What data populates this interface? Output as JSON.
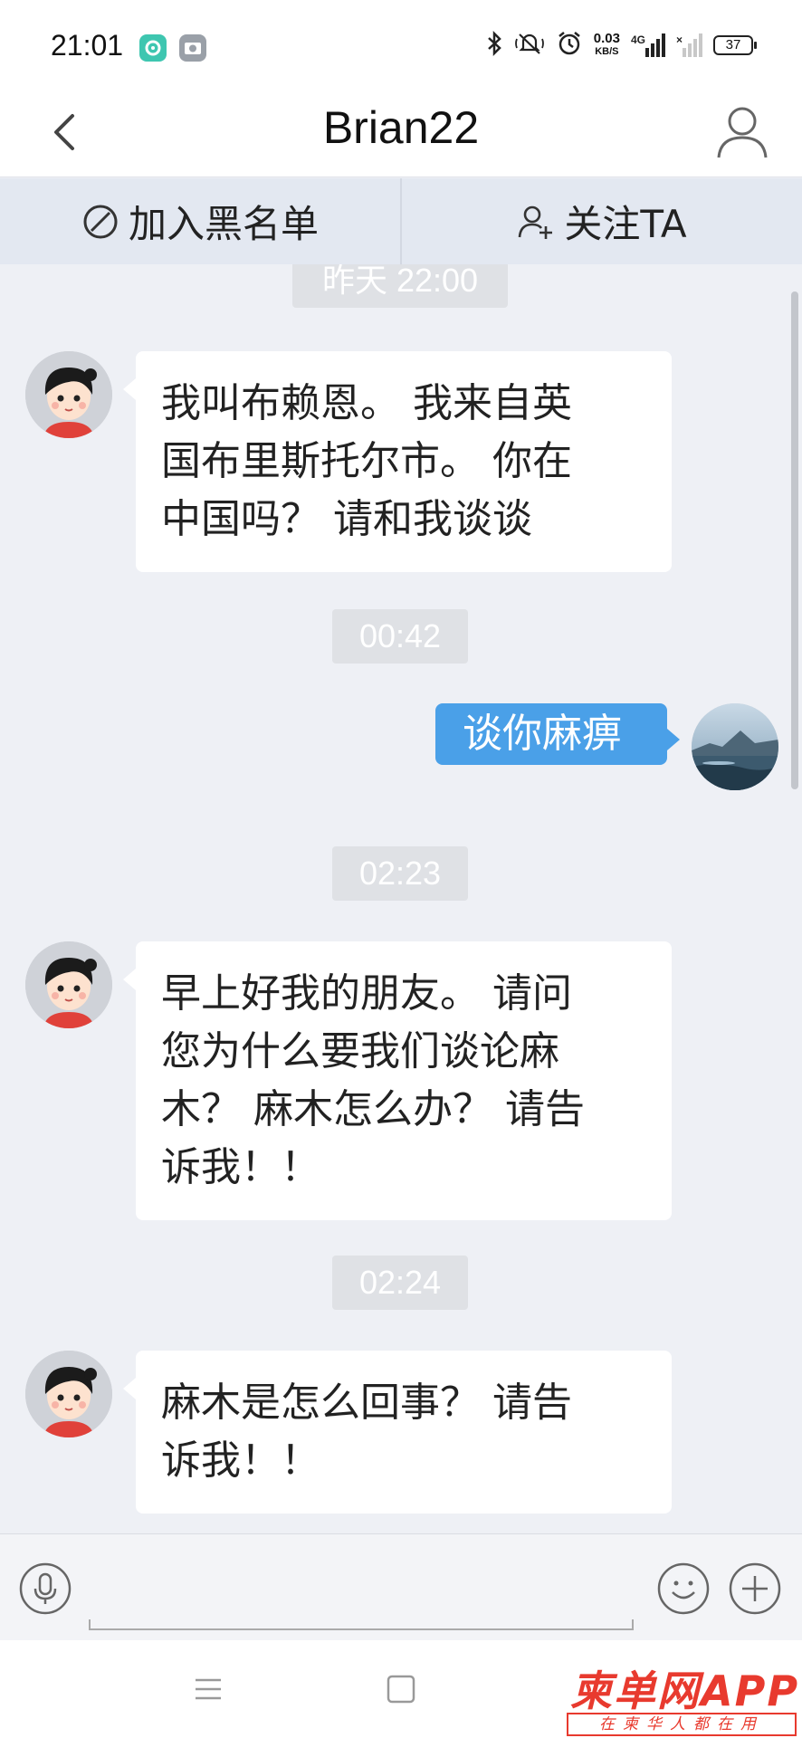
{
  "status_bar": {
    "time": "21:01",
    "net_speed": "0.03",
    "net_unit": "KB/S",
    "network_type": "4G",
    "battery": "37",
    "icons": [
      "app-notify-icon",
      "camera-icon",
      "bluetooth-icon",
      "mute-icon",
      "alarm-icon",
      "signal-icon",
      "no-signal-icon",
      "battery-icon"
    ]
  },
  "header": {
    "title": "Brian22",
    "icons": [
      "back-icon",
      "user-profile-icon"
    ]
  },
  "actions": {
    "block_label": "加入黑名单",
    "follow_label": "关注TA",
    "icons": [
      "block-icon",
      "follow-user-icon"
    ]
  },
  "chat": {
    "timestamps": [
      "昨天 22:00",
      "00:42",
      "02:23",
      "02:24"
    ],
    "messages": [
      {
        "from": "other",
        "lines": [
          "我叫布赖恩。 我来自英",
          "国布里斯托尔市。 你在",
          "中国吗？ 请和我谈谈"
        ]
      },
      {
        "from": "me",
        "lines": [
          "谈你麻痹"
        ]
      },
      {
        "from": "other",
        "lines": [
          "早上好我的朋友。 请问",
          "您为什么要我们谈论麻",
          "木？ 麻木怎么办？ 请告",
          "诉我！！"
        ]
      },
      {
        "from": "other",
        "lines": [
          "麻木是怎么回事？ 请告",
          "诉我！！"
        ]
      }
    ]
  },
  "input_bar": {
    "icons": [
      "microphone-icon",
      "emoji-icon",
      "plus-icon"
    ]
  },
  "nav_bar": {
    "icons": [
      "menu-icon",
      "home-icon"
    ]
  },
  "watermark": {
    "main": "柬单网APP",
    "sub": "在柬华人都在用"
  },
  "colors": {
    "accent_blue": "#4aa0e8",
    "chat_bg": "#eef0f5",
    "action_bar_bg": "#e3e8f1",
    "watermark_red": "#e83a2e"
  }
}
